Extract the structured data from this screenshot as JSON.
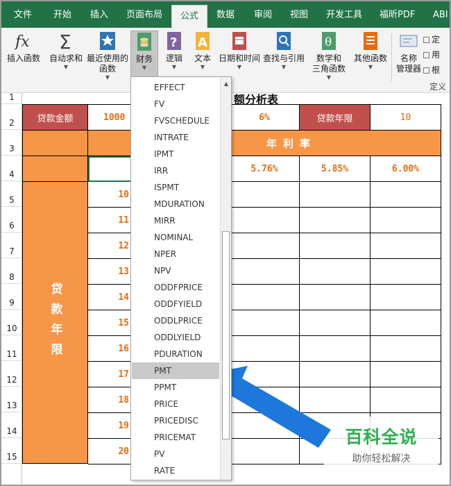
{
  "tabs": [
    "文件",
    "开始",
    "插入",
    "页面布局",
    "公式",
    "数据",
    "审阅",
    "视图",
    "开发工具",
    "福昕PDF",
    "ABI"
  ],
  "ribbon": {
    "insert_function": "插入函数",
    "autosum": "自动求和",
    "recent_line1": "最近使用的",
    "recent_line2": "函数",
    "financial": "财务",
    "logical": "逻辑",
    "text": "文本",
    "datetime": "日期和时间",
    "lookup": "查找与引用",
    "math_line1": "数学和",
    "math_line2": "三角函数",
    "other": "其他函数",
    "name_mgr_line1": "名称",
    "name_mgr_line2": "管理器",
    "define_name": "定",
    "use_in_formula": "用",
    "create_from_sel": "根",
    "group_defined_names": "定义"
  },
  "sheet": {
    "title_fragment": "额分析表",
    "loan_amount_label": "贷款金额",
    "loan_amount_value": "1000",
    "rate_value": "6%",
    "loan_years_label": "贷款年限",
    "loan_years_value": "10",
    "annual_rate": "年 利 率",
    "rates": [
      "5.76%",
      "5.85%",
      "6.00%"
    ],
    "loan_term_vertical": "贷款年限",
    "row_values": [
      "10",
      "11",
      "12",
      "13",
      "14",
      "15",
      "16",
      "17",
      "18",
      "19",
      "20"
    ],
    "row_numbers": [
      "1",
      "2",
      "3",
      "4",
      "5",
      "6",
      "7",
      "8",
      "9",
      "10",
      "11",
      "12",
      "13",
      "14",
      "15"
    ]
  },
  "dropdown": {
    "items": [
      "EFFECT",
      "FV",
      "FVSCHEDULE",
      "INTRATE",
      "IPMT",
      "IRR",
      "ISPMT",
      "MDURATION",
      "MIRR",
      "NOMINAL",
      "NPER",
      "NPV",
      "ODDFPRICE",
      "ODDFYIELD",
      "ODDLPRICE",
      "ODDLYIELD",
      "PDURATION",
      "PMT",
      "PPMT",
      "PRICE",
      "PRICEDISC",
      "PRICEMAT",
      "PV",
      "RATE"
    ],
    "highlighted": "PMT"
  },
  "watermark": {
    "title": "百科全说",
    "subtitle": "助你轻松解决"
  },
  "colors": {
    "tab_bar": "#217346",
    "red_header": "#c0504d",
    "orange_fill": "#f79646",
    "orange_text": "#e46c0a",
    "arrow": "#1e78dc",
    "watermark_green": "#2fae4f"
  }
}
